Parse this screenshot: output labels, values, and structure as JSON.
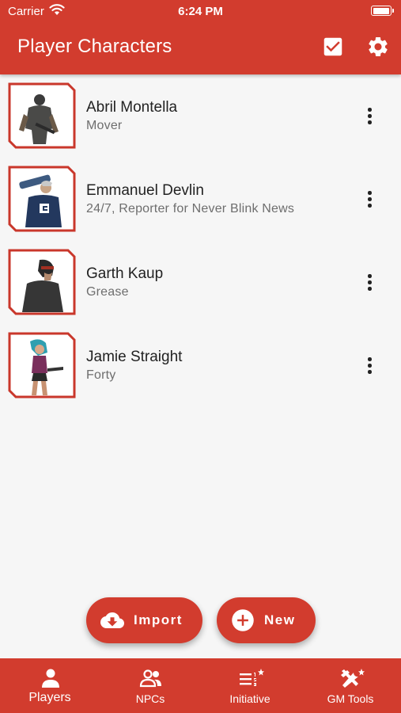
{
  "status_bar": {
    "carrier": "Carrier",
    "time": "6:24 PM"
  },
  "appbar": {
    "title": "Player Characters"
  },
  "characters": [
    {
      "name": "Abril Montella",
      "subtitle": "Mover"
    },
    {
      "name": "Emmanuel Devlin",
      "subtitle": "24/7, Reporter for Never Blink News"
    },
    {
      "name": "Garth Kaup",
      "subtitle": "Grease"
    },
    {
      "name": "Jamie Straight",
      "subtitle": "Forty"
    }
  ],
  "actions": {
    "import_label": "Import",
    "new_label": "New"
  },
  "bottom_nav": {
    "players": "Players",
    "npcs": "NPCs",
    "initiative": "Initiative",
    "gm_tools": "GM Tools"
  },
  "colors": {
    "brand": "#d23c2e",
    "background": "#f6f6f6"
  }
}
